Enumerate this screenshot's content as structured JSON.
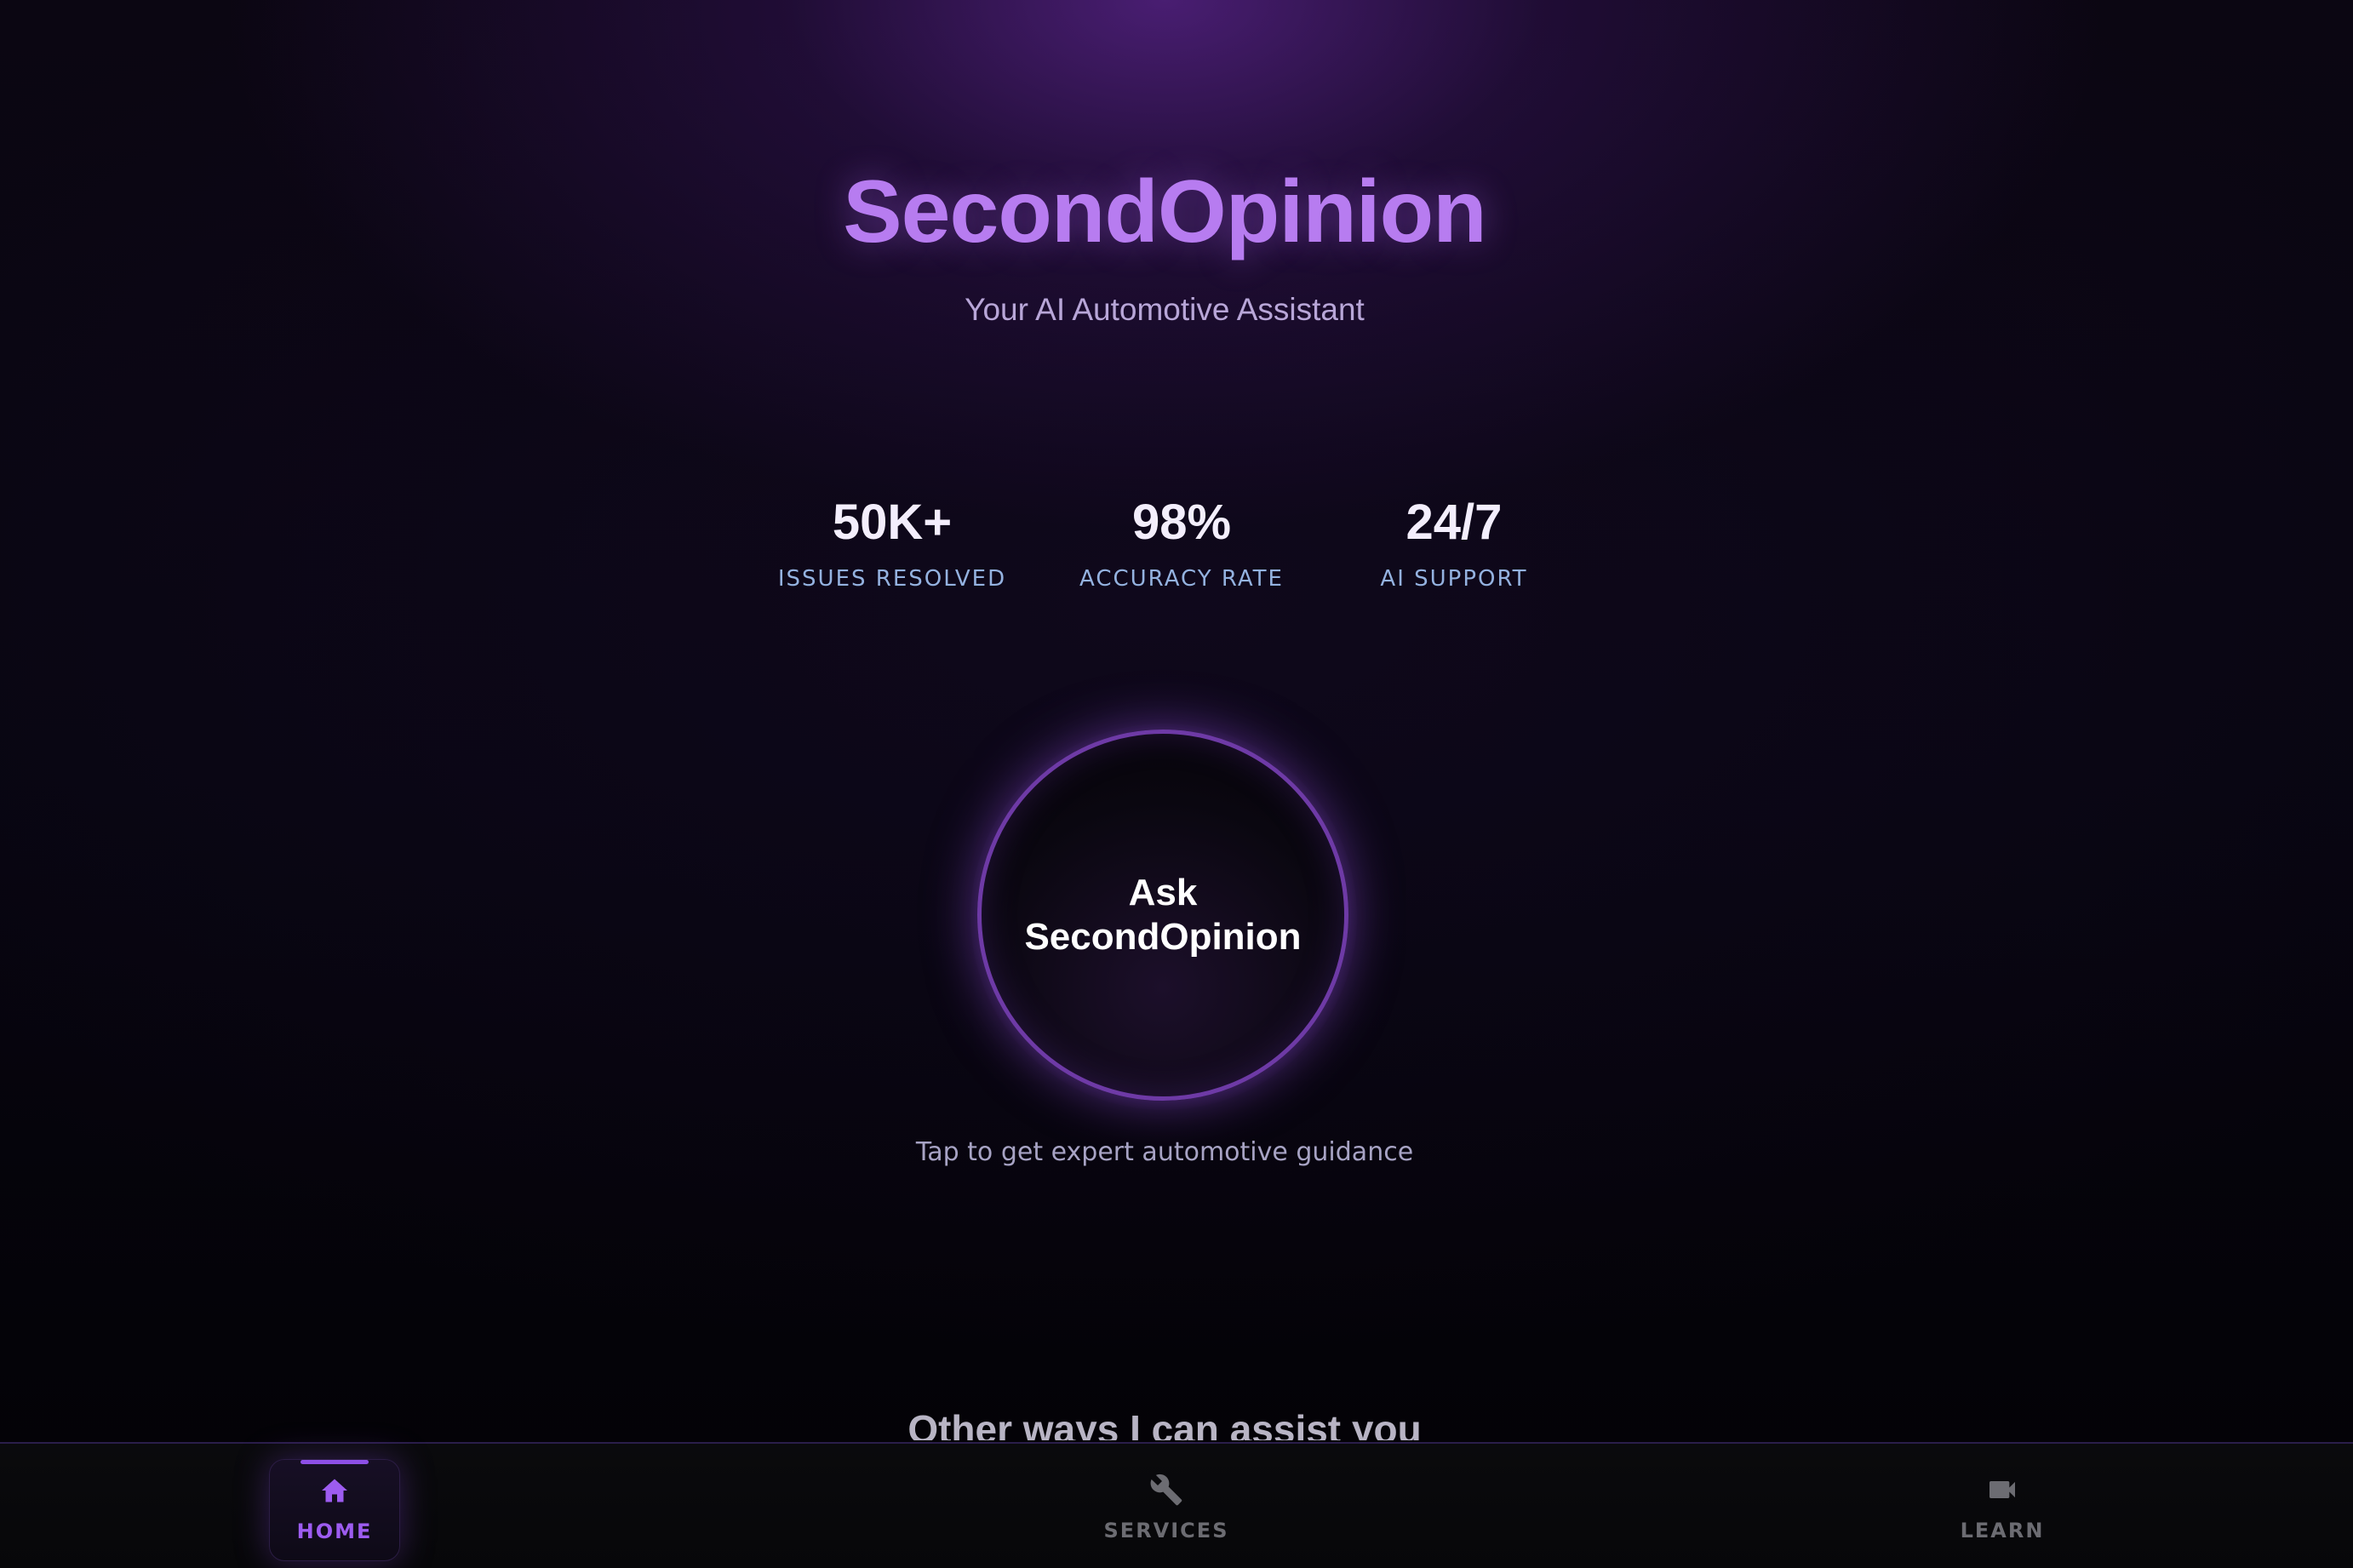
{
  "app": {
    "title": "SecondOpinion",
    "subtitle": "Your AI Automotive Assistant"
  },
  "stats": [
    {
      "value": "50K+",
      "label": "ISSUES RESOLVED"
    },
    {
      "value": "98%",
      "label": "ACCURACY RATE"
    },
    {
      "value": "24/7",
      "label": "AI SUPPORT"
    }
  ],
  "ask": {
    "line1": "Ask",
    "line2": "SecondOpinion",
    "hint": "Tap to get expert automotive guidance"
  },
  "section": {
    "heading": "Other ways I can assist you"
  },
  "tabs": [
    {
      "label": "HOME",
      "icon": "home-icon",
      "active": true
    },
    {
      "label": "SERVICES",
      "icon": "wrench-icon",
      "active": false
    },
    {
      "label": "LEARN",
      "icon": "video-camera-icon",
      "active": false
    }
  ],
  "colors": {
    "accent": "#b77cf0",
    "active_tab": "#9d5cf0",
    "inactive_tab": "#6c6c72",
    "stat_label": "#94b2e0",
    "ring": "#6e3aa6"
  }
}
